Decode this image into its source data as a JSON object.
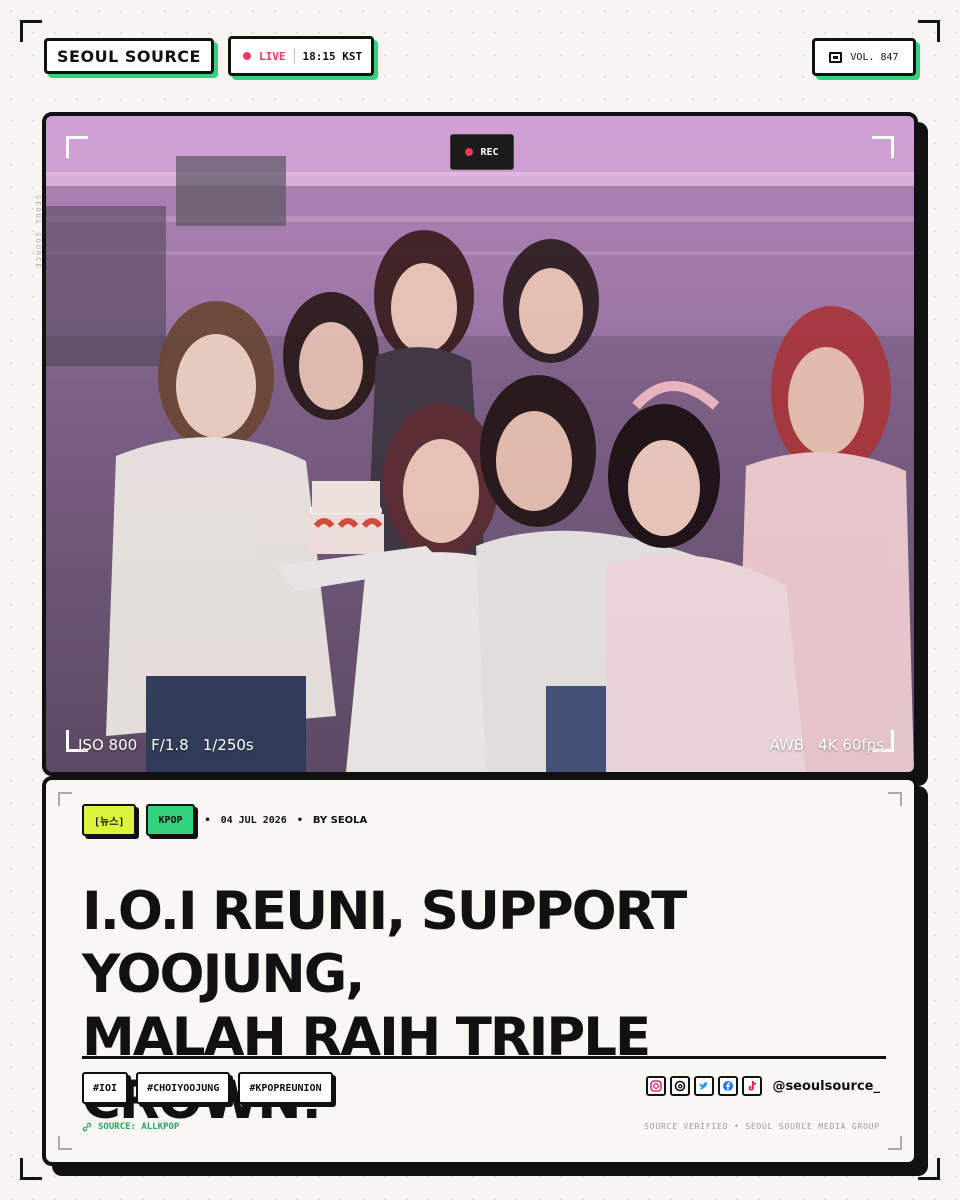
{
  "header": {
    "brand": "SEOUL SOURCE",
    "live_label": "LIVE",
    "time": "18:15 KST",
    "volume": "VOL. 847"
  },
  "side_text": "SEOUL SOURCE",
  "photo": {
    "rec_label": "REC",
    "iso": "ISO 800",
    "aperture": "F/1.8",
    "shutter": "1/250s",
    "white_balance": "AWB",
    "resolution": "4K 60fps"
  },
  "article": {
    "category_tag": "[뉴스]",
    "topic_tag": "KPOP",
    "date": "04 JUL 2026",
    "byline": "BY SEOLA",
    "headline_line1": "I.O.I REUNI, SUPPORT YOOJUNG,",
    "headline_line2": "MALAH RAIH TRIPLE CROWN!",
    "hashtags": [
      "#IOI",
      "#CHOIYOOJUNG",
      "#KPOPREUNION"
    ],
    "social_handle": "@seoulsource_",
    "source": "SOURCE: ALLKPOP",
    "footnote": "SOURCE VERIFIED • SEOUL SOURCE MEDIA GROUP"
  },
  "colors": {
    "accent_green": "#34d17e",
    "accent_lime": "#dcf53c",
    "live_red": "#ef3a5d"
  },
  "icons": [
    "newspaper-icon",
    "record-dot-icon",
    "instagram-icon",
    "threads-icon",
    "twitter-icon",
    "facebook-icon",
    "tiktok-icon",
    "link-icon"
  ]
}
